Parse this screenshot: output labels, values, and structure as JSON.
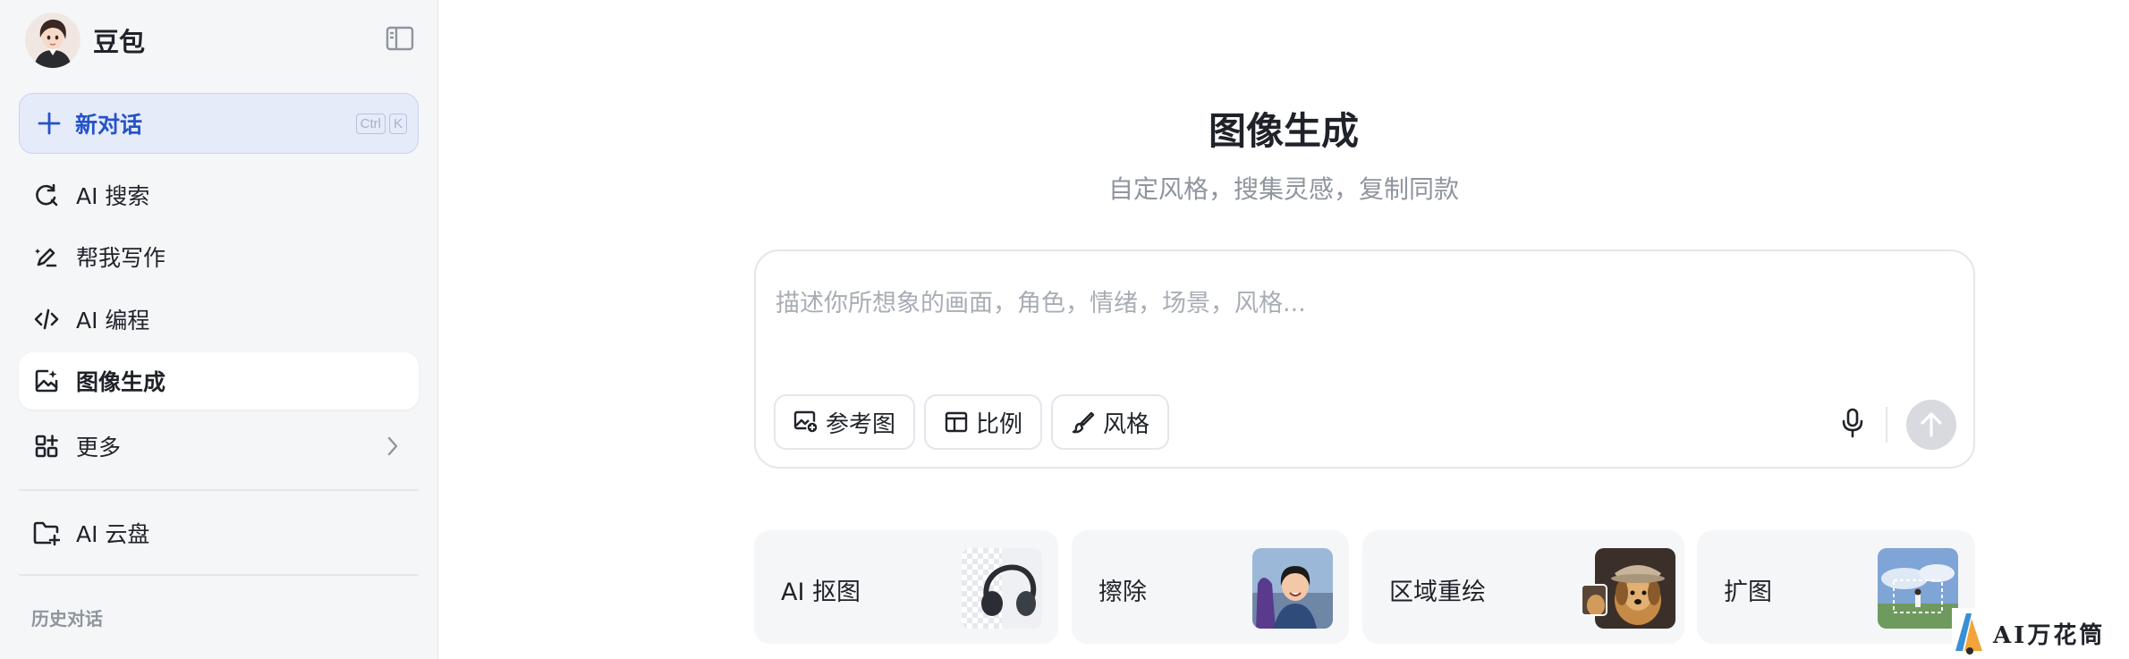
{
  "sidebar": {
    "app_name": "豆包",
    "new_chat": {
      "label": "新对话",
      "shortcut": [
        "Ctrl",
        "K"
      ]
    },
    "items": [
      {
        "label": "AI 搜索",
        "icon": "search-icon"
      },
      {
        "label": "帮我写作",
        "icon": "pen-icon"
      },
      {
        "label": "AI 编程",
        "icon": "code-icon"
      },
      {
        "label": "图像生成",
        "icon": "image-sparkle-icon",
        "active": true
      },
      {
        "label": "更多",
        "icon": "apps-icon"
      },
      {
        "label": "AI 云盘",
        "icon": "folder-icon"
      }
    ],
    "history_title": "历史对话"
  },
  "main": {
    "title": "图像生成",
    "subtitle": "自定风格，搜集灵感，复制同款",
    "prompt_placeholder": "描述你所想象的画面，角色，情绪，场景，风格...",
    "chips": [
      {
        "label": "参考图",
        "icon": "image-add-icon"
      },
      {
        "label": "比例",
        "icon": "ratio-icon"
      },
      {
        "label": "风格",
        "icon": "brush-icon"
      }
    ],
    "tools": [
      {
        "label": "AI 抠图"
      },
      {
        "label": "擦除"
      },
      {
        "label": "区域重绘"
      },
      {
        "label": "扩图"
      }
    ]
  },
  "watermark": {
    "text": "AI万花筒"
  },
  "colors": {
    "accent": "#2453c8",
    "accent_bg": "#e6ebfa",
    "sidebar_bg": "#f5f6f8",
    "muted": "#8f959e"
  }
}
